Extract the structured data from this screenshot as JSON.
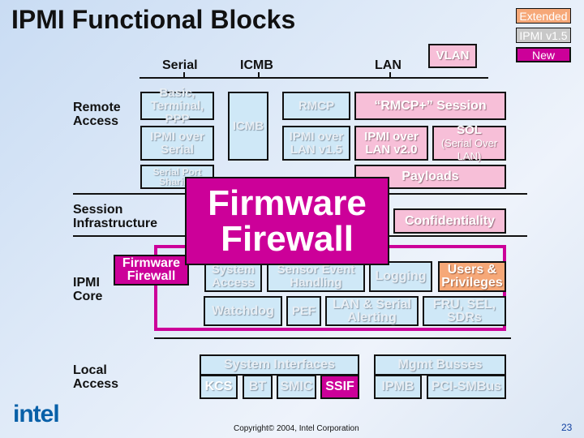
{
  "title": "IPMI Functional Blocks",
  "legend": {
    "extended": "Extended",
    "v15": "IPMI v1.5",
    "new": "New",
    "colors": {
      "extended": "#f6a878",
      "v15": "#c8c8c8",
      "new": "#cc0099"
    }
  },
  "buses": {
    "serial": "Serial",
    "icmb": "ICMB",
    "lan": "LAN",
    "vlan": "VLAN"
  },
  "labels": {
    "remote": "Remote Access",
    "session": "Session Infrastructure",
    "core": "IPMI Core",
    "local": "Local Access"
  },
  "blocks": {
    "basic": "Basic, Terminal, PPP",
    "icmb": "ICMB",
    "rmcp": "RMCP",
    "rmcpplus": "“RMCP+” Session",
    "ipmi_serial": "IPMI over Serial",
    "ipmi_lan15": "IPMI over LAN v1.5",
    "ipmi_lan20": "IPMI over LAN v2.0",
    "sol_main": "SOL",
    "sol_sub": "(Serial Over LAN)",
    "serial_sharing": "Serial Port Sharing",
    "payloads": "Payloads",
    "confidentiality": "Confidentiality",
    "firewall_big": "Firmware Firewall",
    "firewall_small": "Firmware Firewall",
    "system_access": "System Access",
    "sensor": "Sensor Event Handling",
    "logging": "Logging",
    "users": "Users & Privileges",
    "watchdog": "Watchdog",
    "pef": "PEF",
    "alerting": "LAN & Serial Alerting",
    "fru": "FRU, SEL, SDRs",
    "sysif": "System Interfaces",
    "kcs": "KCS",
    "bt": "BT",
    "smic": "SMIC",
    "ssif": "SSIF",
    "mgmt": "Mgmt Busses",
    "ipmb": "IPMB",
    "pcismbus": "PCI-SMBus"
  },
  "footer": {
    "logo": "intel",
    "copyright": "Copyright© 2004, Intel Corporation",
    "page": "23"
  }
}
